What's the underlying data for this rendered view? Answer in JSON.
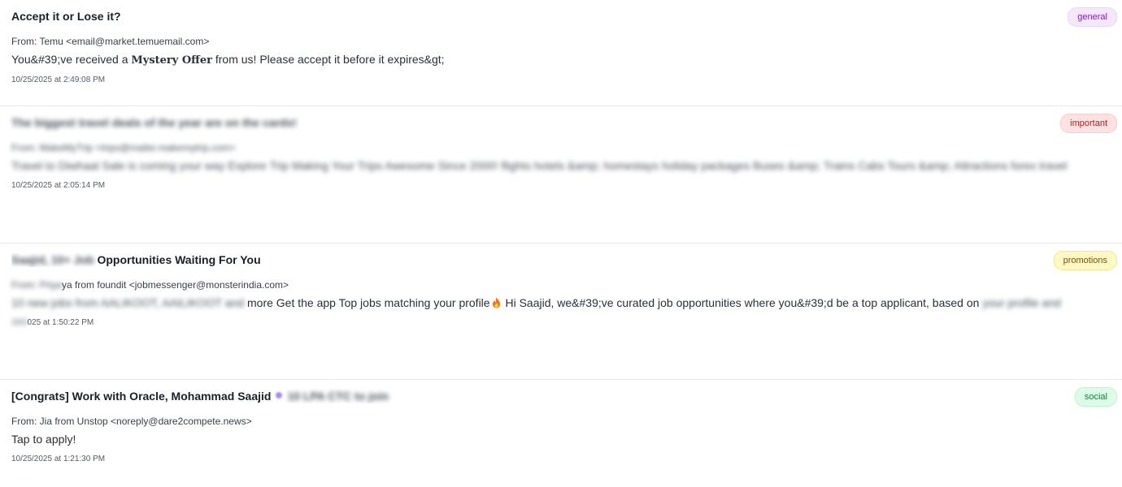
{
  "emails": [
    {
      "subject": "Accept it or Lose it?",
      "from": "From: Temu <email@market.temuemail.com>",
      "preview_before": "You&#39;ve received a ",
      "preview_highlight": "Mystery Offer",
      "preview_after": " from us! Please accept it before it expires&gt;",
      "timestamp": "10/25/2025 at 2:49:08 PM",
      "tag": "general"
    },
    {
      "subject_blurred": "The biggest travel deals of the year are on the cards!",
      "from_blurred": "From: MakeMyTrip <trips@mailer.makemytrip.com>",
      "from_visible": "makemytrip.com>",
      "preview_blurred_start": "Travel to Diwhaal Sale is coming your way",
      "preview_visible": "ning your way",
      "preview_blurred_rest": "Explore Trip Making Your Trips Awesome Since 2000! flights hotels &amp; homestays holiday packages Buses &amp; Trains Cabs Tours &amp; Attractions forex travel",
      "timestamp": "10/25/2025 at 2:05:14 PM",
      "tag": "important"
    },
    {
      "subject_blurred": "Saajid, 10+ Job",
      "subject_visible": "Opportunities Waiting For You",
      "from_blurred": "From: Priya",
      "from_visible": "ya from foundit <jobmessenger@monsterindia.com>",
      "preview_blurred": "10 new jobs from AALIKOOT, AAILIKOOT and",
      "preview_visible": "more Get the app Top jobs matching your profile",
      "preview_after_icon": " Hi Saajid, we&#39;ve curated job opportunities where you&#39;d be a top applicant, based on",
      "preview_blurred_end": "your profile and",
      "timestamp_blurred": "10/2",
      "timestamp_visible": "025 at 1:50:22 PM",
      "tag": "promotions"
    },
    {
      "subject_visible": "[Congrats] Work with Oracle, Mohammad Saajid",
      "subject_blurred": "10 LPA CTC to join",
      "from": "From: Jia from Unstop <noreply@dare2compete.news>",
      "preview": "Tap to apply!",
      "timestamp": "10/25/2025 at 1:21:30 PM",
      "tag": "social"
    }
  ],
  "colors": {
    "general": "#7e22ce",
    "important": "#b91c1c",
    "promotions": "#854d0e",
    "social": "#15803d"
  },
  "icons": {
    "fire": "fire-icon"
  }
}
